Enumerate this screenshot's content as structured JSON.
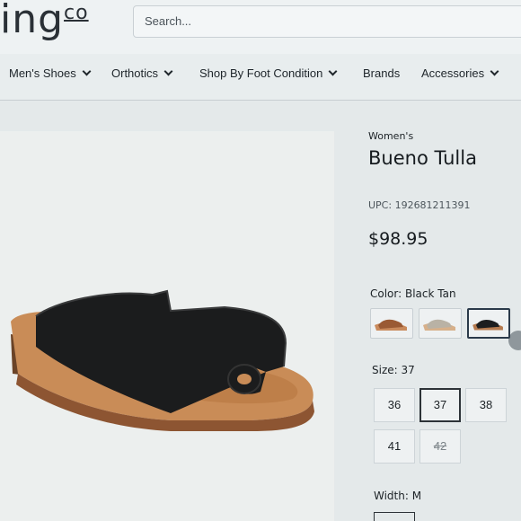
{
  "header": {
    "logo_text": "ing",
    "logo_suffix": "co",
    "search_placeholder": "Search..."
  },
  "nav": {
    "items": [
      {
        "label": "Men's Shoes",
        "has_dropdown": true
      },
      {
        "label": "Orthotics",
        "has_dropdown": true
      },
      {
        "label": "Shop By Foot Condition",
        "has_dropdown": true
      },
      {
        "label": "Brands",
        "has_dropdown": false
      },
      {
        "label": "Accessories",
        "has_dropdown": true
      }
    ]
  },
  "product": {
    "category": "Women's",
    "title": "Bueno Tulla",
    "upc": "UPC: 192681211391",
    "price": "$98.95",
    "color_label": "Color: Black Tan",
    "colors": [
      {
        "name": "Tan",
        "upper": "#9a5a34",
        "sole": "#c98a5c",
        "selected": false
      },
      {
        "name": "Taupe",
        "upper": "#b9b2a5",
        "sole": "#d7b08a",
        "selected": false
      },
      {
        "name": "Black Tan",
        "upper": "#1d1e1f",
        "sole": "#b57a4e",
        "selected": true
      }
    ],
    "size_label": "Size: 37",
    "sizes": [
      {
        "label": "36",
        "selected": false,
        "available": true
      },
      {
        "label": "37",
        "selected": true,
        "available": true
      },
      {
        "label": "38",
        "selected": false,
        "available": true
      },
      {
        "label": "41",
        "selected": false,
        "available": true
      },
      {
        "label": "42",
        "selected": false,
        "available": false
      }
    ],
    "width_label": "Width: M"
  },
  "colors": {
    "accent_border": "#2b3a4a",
    "background": "#e4e9ea"
  }
}
